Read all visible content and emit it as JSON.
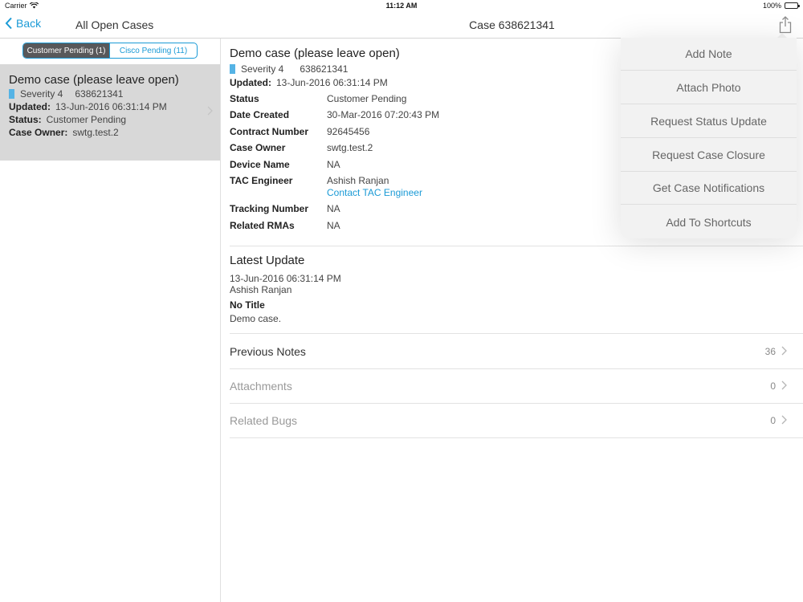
{
  "status_bar": {
    "carrier": "Carrier",
    "time": "11:12 AM",
    "battery": "100%"
  },
  "nav": {
    "back_label": "Back",
    "left_title": "All Open Cases",
    "title": "Case 638621341"
  },
  "segments": [
    {
      "label": "Customer Pending (1)",
      "selected": true
    },
    {
      "label": "Cisco Pending (11)",
      "selected": false
    }
  ],
  "case_list": [
    {
      "title": "Demo case (please leave open)",
      "severity": "Severity 4",
      "case_number": "638621341",
      "updated_label": "Updated:",
      "updated": "13-Jun-2016 06:31:14 PM",
      "status_label": "Status:",
      "status": "Customer Pending",
      "owner_label": "Case Owner:",
      "owner": "swtg.test.2"
    }
  ],
  "case": {
    "title": "Demo case (please leave open)",
    "severity": "Severity 4",
    "case_number": "638621341",
    "updated_label": "Updated:",
    "updated": "13-Jun-2016 06:31:14 PM",
    "details": [
      {
        "label": "Status",
        "value": "Customer Pending"
      },
      {
        "label": "Date Created",
        "value": "30-Mar-2016 07:20:43 PM"
      },
      {
        "label": "Contract Number",
        "value": "92645456"
      },
      {
        "label": "Case Owner",
        "value": "swtg.test.2"
      },
      {
        "label": "Device Name",
        "value": "NA"
      },
      {
        "label": "TAC Engineer",
        "value": "Ashish Ranjan",
        "link": "Contact TAC Engineer"
      },
      {
        "label": "Tracking Number",
        "value": "NA"
      },
      {
        "label": "Related RMAs",
        "value": "NA"
      }
    ],
    "latest_update": {
      "heading": "Latest Update",
      "date": "13-Jun-2016 06:31:14 PM",
      "author": "Ashish Ranjan",
      "note_title": "No Title",
      "body": "Demo case."
    },
    "rows": [
      {
        "label": "Previous Notes",
        "count": "36",
        "enabled": true
      },
      {
        "label": "Attachments",
        "count": "0",
        "enabled": false
      },
      {
        "label": "Related Bugs",
        "count": "0",
        "enabled": false
      }
    ]
  },
  "actions_menu": [
    "Add Note",
    "Attach Photo",
    "Request Status Update",
    "Request Case Closure",
    "Get Case Notifications",
    "Add To Shortcuts"
  ],
  "colors": {
    "accent": "#1a9ad6",
    "severity_marker": "#55b3e5",
    "selected_row": "#d8d8d8"
  },
  "icons": [
    "wifi-icon",
    "battery-icon",
    "back-chevron-icon",
    "share-icon",
    "chevron-right-icon"
  ]
}
